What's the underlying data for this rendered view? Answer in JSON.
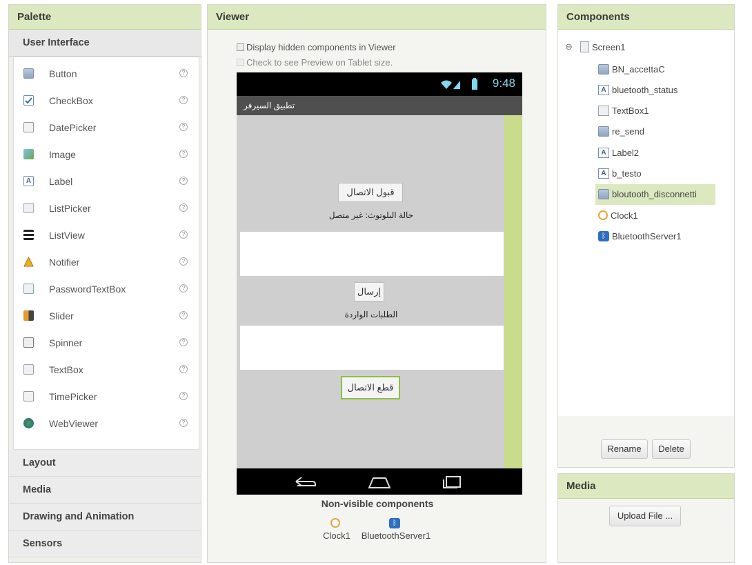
{
  "palette": {
    "title": "Palette",
    "open_category": "User Interface",
    "help_glyph": "?",
    "items": [
      {
        "label": "Button",
        "icon": "button-icon"
      },
      {
        "label": "CheckBox",
        "icon": "checkbox-icon"
      },
      {
        "label": "DatePicker",
        "icon": "datepicker-icon"
      },
      {
        "label": "Image",
        "icon": "image-icon"
      },
      {
        "label": "Label",
        "icon": "label-icon"
      },
      {
        "label": "ListPicker",
        "icon": "listpicker-icon"
      },
      {
        "label": "ListView",
        "icon": "listview-icon"
      },
      {
        "label": "Notifier",
        "icon": "notifier-icon"
      },
      {
        "label": "PasswordTextBox",
        "icon": "password-icon"
      },
      {
        "label": "Slider",
        "icon": "slider-icon"
      },
      {
        "label": "Spinner",
        "icon": "spinner-icon"
      },
      {
        "label": "TextBox",
        "icon": "textbox-icon"
      },
      {
        "label": "TimePicker",
        "icon": "timepicker-icon"
      },
      {
        "label": "WebViewer",
        "icon": "webviewer-icon"
      }
    ],
    "categories": [
      "Layout",
      "Media",
      "Drawing and Animation",
      "Sensors"
    ]
  },
  "viewer": {
    "title": "Viewer",
    "display_hidden": "Display hidden components in Viewer",
    "tablet_preview": "Check to see Preview on Tablet size.",
    "phone": {
      "time": "9:48",
      "app_title": "تطبيق السيرفر",
      "accept_button": "قبول الاتصال",
      "status_label": "حالة البلوتوث: غير متصل",
      "send_button": "إرسال",
      "incoming_label": "الطلبات الواردة",
      "disconnect_button": "قطع الاتصال"
    },
    "nonvisible_title": "Non-visible components",
    "nonvisible": [
      "Clock1",
      "BluetoothServer1"
    ]
  },
  "components": {
    "title": "Components",
    "collapse_glyph": "⊖",
    "root": "Screen1",
    "children": [
      {
        "label": "BN_accettaC",
        "icon": "button-icon"
      },
      {
        "label": "bluetooth_status",
        "icon": "label-icon"
      },
      {
        "label": "TextBox1",
        "icon": "textbox-icon"
      },
      {
        "label": "re_send",
        "icon": "button-icon"
      },
      {
        "label": "Label2",
        "icon": "label-icon"
      },
      {
        "label": "b_testo",
        "icon": "label-icon"
      },
      {
        "label": "bloutooth_disconnetti",
        "icon": "button-icon",
        "selected": true
      },
      {
        "label": "Clock1",
        "icon": "clock-icon"
      },
      {
        "label": "BluetoothServer1",
        "icon": "bluetooth-icon"
      }
    ],
    "rename": "Rename",
    "delete": "Delete"
  },
  "media": {
    "title": "Media",
    "upload": "Upload File ..."
  }
}
